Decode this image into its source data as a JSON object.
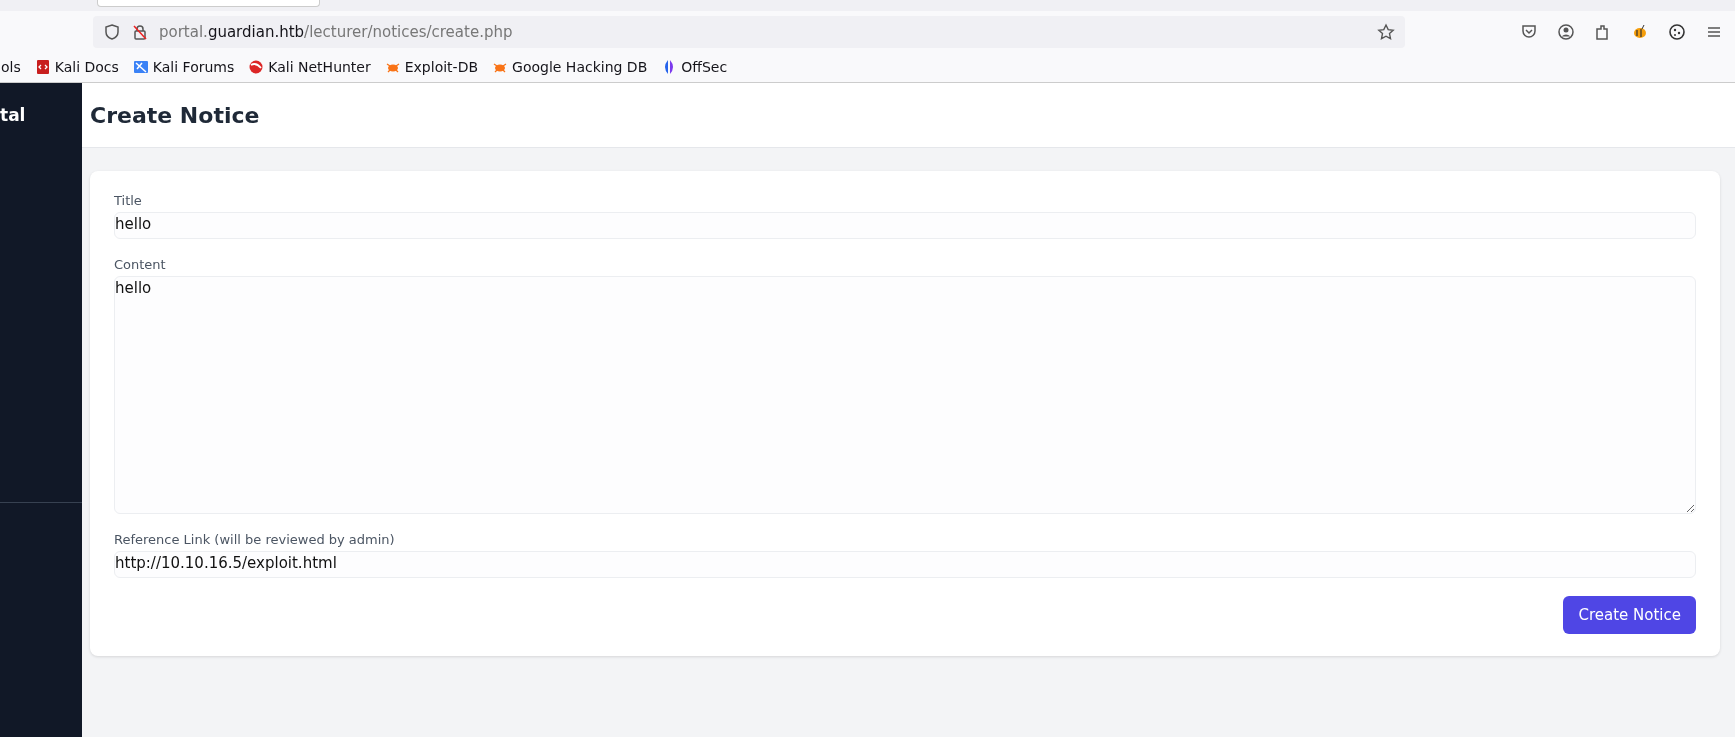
{
  "browser": {
    "url_host_prefix": "portal.",
    "url_domain": "guardian.htb",
    "url_path": "/lecturer/notices/create.php",
    "bookmarks": [
      {
        "label": "ols",
        "kind": "cut"
      },
      {
        "label": "Kali Docs",
        "kind": "docs"
      },
      {
        "label": "Kali Forums",
        "kind": "forums"
      },
      {
        "label": "Kali NetHunter",
        "kind": "nethunter"
      },
      {
        "label": "Exploit-DB",
        "kind": "bug"
      },
      {
        "label": "Google Hacking DB",
        "kind": "bug"
      },
      {
        "label": "OffSec",
        "kind": "offsec"
      }
    ]
  },
  "sidebar": {
    "title": "tal"
  },
  "page": {
    "title": "Create Notice"
  },
  "form": {
    "fields": [
      {
        "label": "Title",
        "value": "hello",
        "kind": "input"
      },
      {
        "label": "Content",
        "value": "hello",
        "kind": "textarea"
      },
      {
        "label": "Reference Link (will be reviewed by admin)",
        "value": "http://10.10.16.5/exploit.html",
        "kind": "input"
      }
    ],
    "submit": "Create Notice"
  }
}
